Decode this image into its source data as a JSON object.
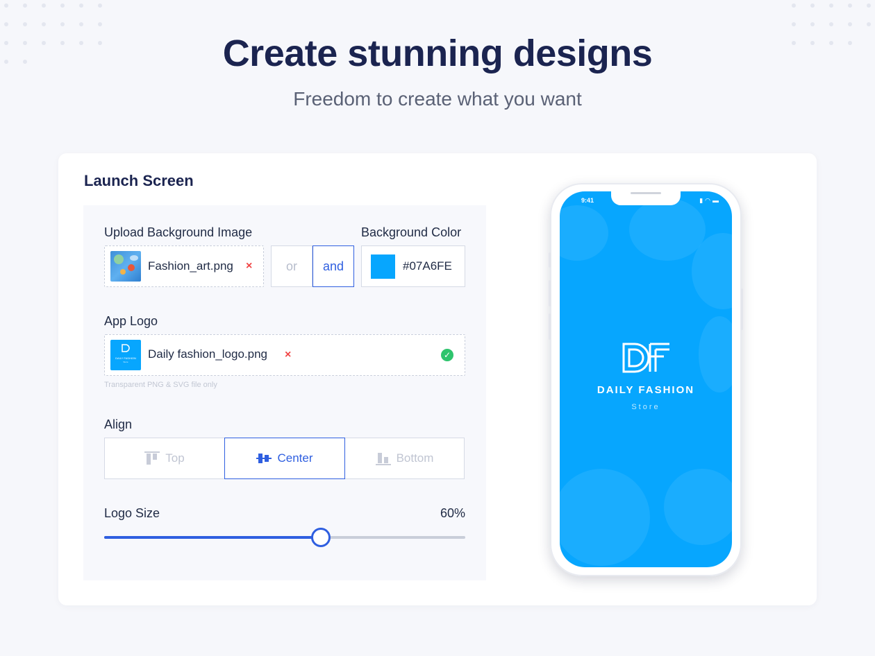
{
  "hero": {
    "title": "Create stunning designs",
    "subtitle": "Freedom to create what you want"
  },
  "card": {
    "title": "Launch Screen"
  },
  "background_image": {
    "label": "Upload Background Image",
    "file_name": "Fashion_art.png",
    "remove_glyph": "×"
  },
  "combine_toggle": {
    "options": [
      "or",
      "and"
    ],
    "selected": "and"
  },
  "background_color": {
    "label": "Background Color",
    "hex": "#07A6FE"
  },
  "app_logo": {
    "label": "App Logo",
    "file_name": "Daily fashion_logo.png",
    "remove_glyph": "×",
    "check_glyph": "✓",
    "hint": "Transparent PNG & SVG file only"
  },
  "align": {
    "label": "Align",
    "options": [
      "Top",
      "Center",
      "Bottom"
    ],
    "selected": "Center"
  },
  "logo_size": {
    "label": "Logo Size",
    "value_text": "60%",
    "value": 0.6
  },
  "phone": {
    "time": "9:41",
    "status_icons": [
      "signal-icon",
      "wifi-icon",
      "battery-icon"
    ],
    "brand": "DAILY FASHION",
    "tagline": "Store"
  },
  "colors": {
    "accent": "#2f5fe0",
    "brand_blue": "#07A6FE",
    "title": "#1b2450",
    "success": "#2ec46d",
    "danger": "#f04444"
  }
}
